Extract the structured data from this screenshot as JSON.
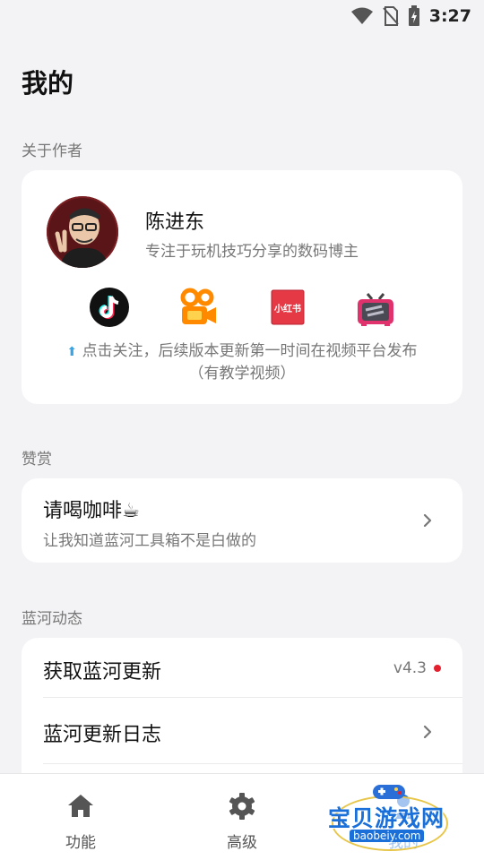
{
  "status_bar": {
    "time": "3:27"
  },
  "page_title": "我的",
  "author_section": {
    "label": "关于作者",
    "name": "陈进东",
    "bio": "专注于玩机技巧分享的数码博主",
    "follow_note_line1": "点击关注，后续版本更新第一时间在视频平台发布",
    "follow_note_line2": "（有教学视频）",
    "social_icons": [
      "douyin-icon",
      "kuaishou-icon",
      "xiaohongshu-icon",
      "bilibili-icon"
    ],
    "xiaohongshu_text": "小红书"
  },
  "reward_section": {
    "label": "赞赏",
    "title": "请喝咖啡☕",
    "subtitle": "让我知道蓝河工具箱不是白做的"
  },
  "lanhe_section": {
    "label": "蓝河动态",
    "items": [
      {
        "title": "获取蓝河更新",
        "version": "v4.3"
      },
      {
        "title": "蓝河更新日志"
      }
    ]
  },
  "bottom_nav": {
    "items": [
      {
        "label": "功能",
        "icon": "home-icon"
      },
      {
        "label": "高级",
        "icon": "gear-icon"
      },
      {
        "label": "我的",
        "icon": "person-icon"
      }
    ]
  },
  "watermark": {
    "text": "宝贝游戏网",
    "url": "baobeiy.com"
  },
  "colors": {
    "accent_blue": "#3aa3e3",
    "red_dot": "#e5202e",
    "background": "#f3f3f5"
  }
}
